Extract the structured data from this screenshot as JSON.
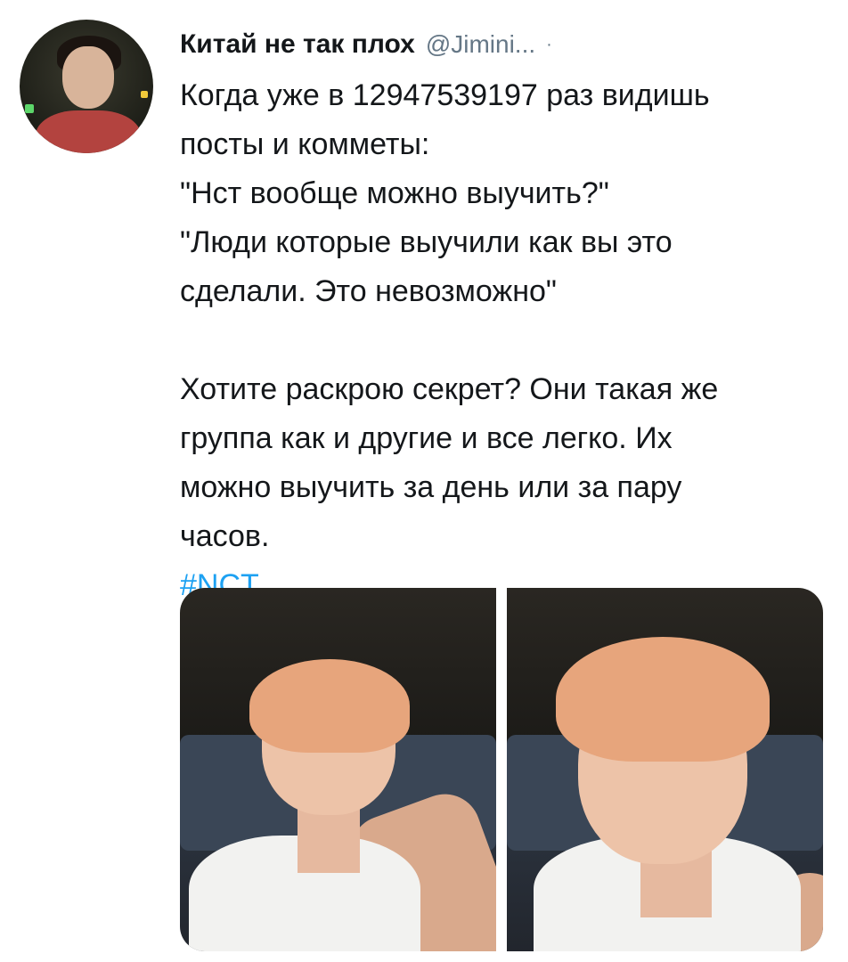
{
  "tweet": {
    "author": {
      "display_name": "Китай не так плох",
      "handle": "@Jimini...",
      "separator": "·"
    },
    "text_lines": [
      "Когда уже в 12947539197 раз видишь",
      "посты и комметы:",
      "\"Нст вообще можно выучить?\"",
      "\"Люди которые выучили как вы это",
      "сделали. Это невозможно\"",
      "",
      "Хотите раскрою секрет? Они такая же",
      "группа  как и другие и все легко. Их",
      "можно выучить за день или за пару",
      "часов."
    ],
    "hashtag": "#NCT",
    "media_count": 2
  },
  "colors": {
    "text": "#14171a",
    "secondary": "#657786",
    "link": "#1da1f2",
    "background": "#ffffff"
  }
}
